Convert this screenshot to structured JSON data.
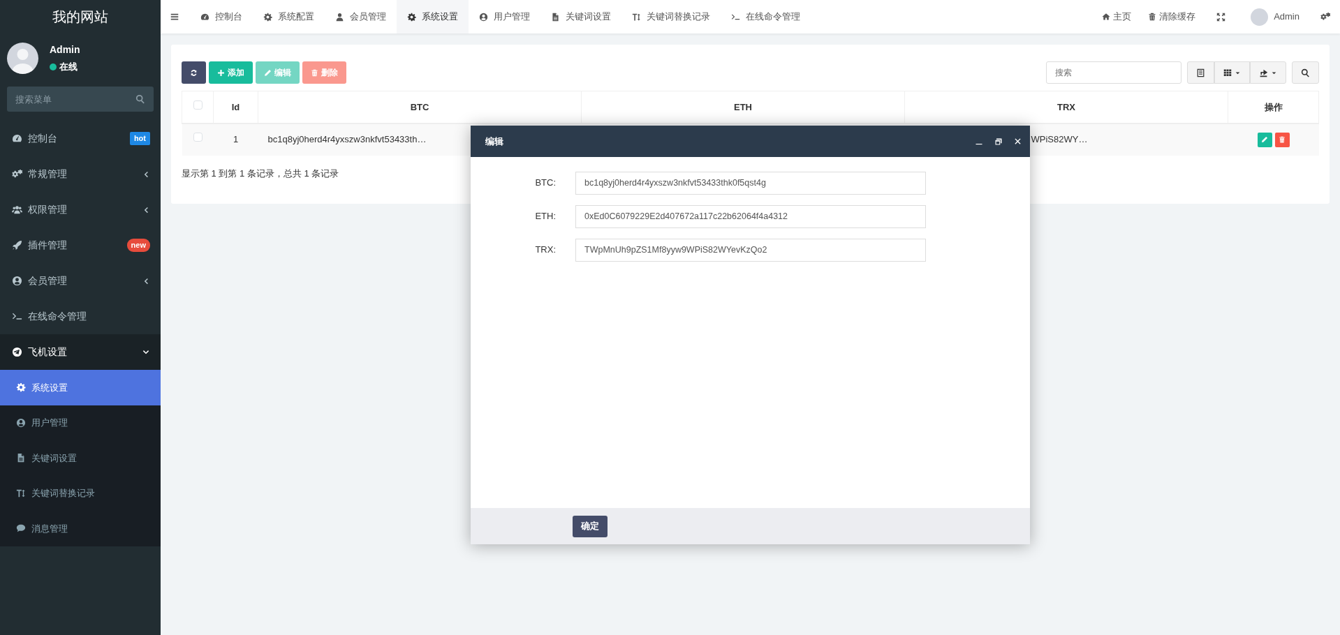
{
  "sidebar": {
    "logo": "我的网站",
    "user": {
      "name": "Admin",
      "status": "在线",
      "online": true
    },
    "search": {
      "placeholder": "搜索菜单"
    },
    "items": [
      {
        "label": "控制台",
        "selected": false,
        "badge": {
          "text": "hot",
          "color": "#1e88e5"
        }
      },
      {
        "label": "常规管理",
        "selected": false,
        "expanded": false
      },
      {
        "label": "权限管理",
        "selected": false,
        "expanded": false
      },
      {
        "label": "插件管理",
        "selected": false,
        "badge": {
          "text": "new",
          "color": "#e74c3c"
        }
      },
      {
        "label": "会员管理",
        "selected": false,
        "expanded": false
      },
      {
        "label": "在线命令管理",
        "selected": false
      },
      {
        "label": "飞机设置",
        "selected": false,
        "expanded": true,
        "children": [
          {
            "label": "系统设置",
            "selected": true
          },
          {
            "label": "用户管理",
            "selected": false
          },
          {
            "label": "关键词设置",
            "selected": false
          },
          {
            "label": "关键词替换记录",
            "selected": false
          },
          {
            "label": "消息管理",
            "selected": false
          }
        ]
      }
    ]
  },
  "tabs": [
    {
      "label": "控制台",
      "selected": false
    },
    {
      "label": "系统配置",
      "selected": false
    },
    {
      "label": "会员管理",
      "selected": false
    },
    {
      "label": "系统设置",
      "selected": true
    },
    {
      "label": "用户管理",
      "selected": false
    },
    {
      "label": "关键词设置",
      "selected": false
    },
    {
      "label": "关键词替换记录",
      "selected": false
    },
    {
      "label": "在线命令管理",
      "selected": false
    }
  ],
  "header_right": {
    "home": "主页",
    "clear_cache": "清除缓存",
    "user": "Admin"
  },
  "toolbar": {
    "buttons": [
      {
        "kind": "refresh",
        "disabled": false
      },
      {
        "kind": "add",
        "label": "添加",
        "disabled": false
      },
      {
        "kind": "edit",
        "label": "编辑",
        "disabled": true
      },
      {
        "kind": "delete",
        "label": "删除",
        "disabled": true
      }
    ],
    "search": {
      "placeholder": "搜索"
    }
  },
  "table": {
    "header_checked": false,
    "columns": [
      "Id",
      "BTC",
      "ETH",
      "TRX",
      "操作"
    ],
    "rows": [
      {
        "checked": false,
        "id": "1",
        "btc": "bc1q8yj0herd4r4yxszw3nkfvt53433th…",
        "trx": "WPiS82WY…"
      }
    ]
  },
  "pagination": "显示第 1 到第 1 条记录，总共 1 条记录",
  "modal": {
    "title": "编辑",
    "fields": [
      {
        "label": "BTC:",
        "value": "bc1q8yj0herd4r4yxszw3nkfvt53433thk0f5qst4g"
      },
      {
        "label": "ETH:",
        "value": "0xEd0C6079229E2d407672a117c22b62064f4a4312"
      },
      {
        "label": "TRX:",
        "value": "TWpMnUh9pZS1Mf8yyw9WPiS82WYevKzQo2"
      }
    ],
    "button": "确定"
  }
}
